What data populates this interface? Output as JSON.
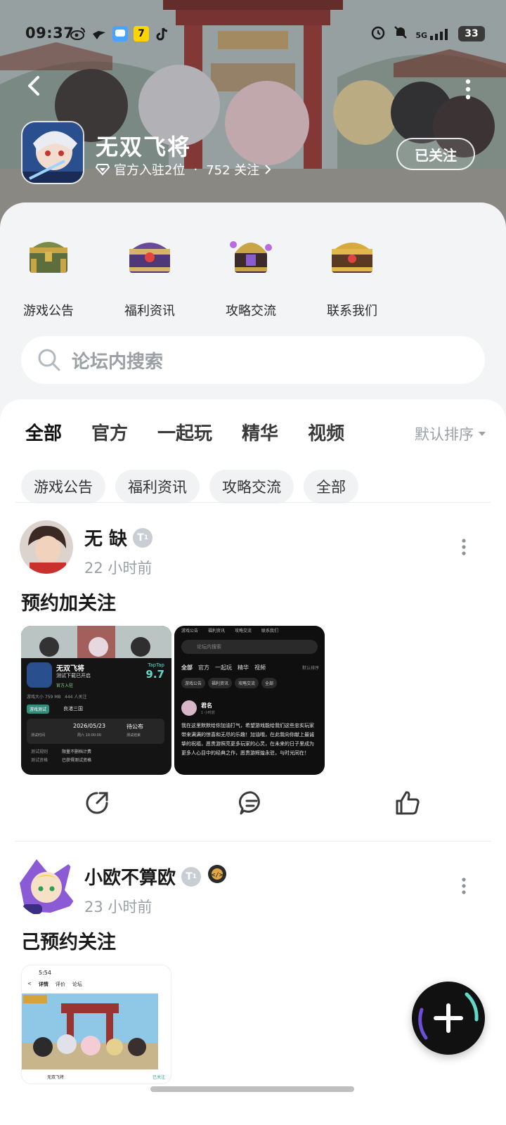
{
  "status": {
    "time": "09:37",
    "network": "5G",
    "battery": "33"
  },
  "header": {
    "game_title": "无双飞将",
    "official_rank": "官方入驻2位",
    "separator": "·",
    "followers": "752 关注",
    "follow_button": "已关注"
  },
  "quick_links": [
    {
      "label": "游戏公告"
    },
    {
      "label": "福利资讯"
    },
    {
      "label": "攻略交流"
    },
    {
      "label": "联系我们"
    }
  ],
  "search": {
    "placeholder": "论坛内搜索"
  },
  "tabs": [
    {
      "label": "全部",
      "active": true
    },
    {
      "label": "官方"
    },
    {
      "label": "一起玩"
    },
    {
      "label": "精华"
    },
    {
      "label": "视频"
    }
  ],
  "sort": {
    "label": "默认排序"
  },
  "chips": [
    {
      "label": "游戏公告"
    },
    {
      "label": "福利资讯"
    },
    {
      "label": "攻略交流"
    },
    {
      "label": "全部"
    }
  ],
  "posts": [
    {
      "username": "无 缺",
      "badge_level": "1",
      "time": "22 小时前",
      "title": "预约加关注",
      "thumb1": {
        "game": "无双飞将",
        "status": "测试下载已开启",
        "official": "官方入驻",
        "size": "游戏大小 759 MB",
        "follow": "444 人关注",
        "score_brand": "TapTap",
        "score": "9.7",
        "tag1": "游戏测试",
        "tag2": "良渚三国",
        "date": "2026/05/23",
        "weekday": "周六 10:00:00",
        "end": "待公布",
        "end_sub": "测试结束",
        "test_time": "测试时间",
        "rule_label": "测试规则",
        "rule_value": "限量不删档计费",
        "qual_label": "测试资格",
        "qual_value": "已获得测试资格"
      },
      "thumb2": {
        "tabs": [
          "游戏公告",
          "福利资讯",
          "攻略交流",
          "联系我们"
        ],
        "search": "论坛内搜索",
        "nav": [
          "全部",
          "官方",
          "一起玩",
          "精华",
          "视频"
        ],
        "sort": "默认排序",
        "chips": [
          "游戏公告",
          "福利资讯",
          "攻略交流",
          "全部"
        ],
        "user": "君名",
        "time": "1 小时前",
        "body": "我在这里默默给你加油打气，希望游戏能给我们这些忠实玩家带来满满的惊喜和无尽的乐趣！加油哦，在此我向你献上最诚挚的祝福，愿贵游照亮更多玩家的心灵，在未来的日子里成为更多人心目中的经典之作，愿贵游辉煌永驻，与时光同在！"
      }
    },
    {
      "username": "小欧不算欧",
      "badge_level": "1",
      "time": "23 小时前",
      "title": "己预约关注",
      "thumb1": {
        "time": "5:54",
        "tabs": [
          "详情",
          "评价",
          "论坛"
        ],
        "game": "无双飞将",
        "follow": "已关注"
      }
    }
  ],
  "colors": {
    "accent": "#5fd9c9",
    "sheet_bg": "#f2f4f5",
    "text_gray": "#9aa0a4"
  }
}
